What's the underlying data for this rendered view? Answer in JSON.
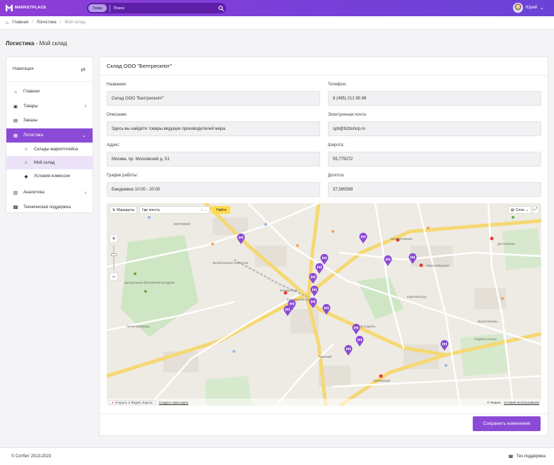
{
  "header": {
    "logo_text": "MARKETPLACE",
    "search_scope": "Товар",
    "search_placeholder": "Поиск",
    "user_name": "Юрий"
  },
  "breadcrumb": [
    "Главная",
    "Логистика",
    "Мой склад"
  ],
  "page_title": {
    "section": "Логистика",
    "rest": " - Мой склад"
  },
  "sidebar": {
    "title": "Навигация",
    "items": [
      {
        "label": "Главная",
        "icon": "home-icon"
      },
      {
        "label": "Товары",
        "icon": "box-icon"
      },
      {
        "label": "Заказы",
        "icon": "orders-icon"
      },
      {
        "label": "Логистика",
        "icon": "logistics-icon"
      },
      {
        "label": "Аналитика",
        "icon": "chart-icon"
      },
      {
        "label": "Техническая поддержка",
        "icon": "support-icon"
      }
    ],
    "subitems": [
      {
        "label": "Склады маркетплейса",
        "icon": "warehouses-icon"
      },
      {
        "label": "Мой склад",
        "icon": "warehouse-icon"
      },
      {
        "label": "Условия комиссии",
        "icon": "tag-icon"
      }
    ]
  },
  "card": {
    "title": "Склад ООО \"Белтрескпот\"",
    "fields": {
      "name": {
        "label": "Название:",
        "value": "Склад ООО \"Белтрескопт\""
      },
      "phone": {
        "label": "Телефон:",
        "value": "8 (495) 212 85 89"
      },
      "description": {
        "label": "Описание:",
        "value": "Здесь вы найдёте товары ведущих производителей мира."
      },
      "email": {
        "label": "Электронная почта:",
        "value": "spb@b2bshop.ru"
      },
      "address": {
        "label": "Адрес:",
        "value": "Москва, пр. Московский д. 51"
      },
      "latitude": {
        "label": "Широта:",
        "value": "55,775072"
      },
      "schedule": {
        "label": "График работы:",
        "value": "Ежедневно 10:00 - 20:00"
      },
      "longitude": {
        "label": "Долгота:",
        "value": "37,585569"
      }
    },
    "save_label": "Сохранить изменения"
  },
  "map": {
    "routes_label": "Маршруты",
    "search_placeholder": "Где поесть",
    "find_label": "Найти",
    "layers_label": "Слои",
    "open_in_yandex": "Открыть в Яндекс.Картах",
    "create_map": "Создать свою карту",
    "copyright": "© Яндекс",
    "terms": "Условия использования",
    "places": [
      "ВЕРХОВОЙ",
      "Менделеевская",
      "Новослободская",
      "Достоевская",
      "Белорусская",
      "Белорусский вокзал",
      "Маяковская",
      "Садовое кольцо",
      "Музей русского искусства",
      "Центральный Московский ипподром",
      "Геологоразведка",
      "Музей Москвы",
      "Музей усадьбы",
      "Гимназия",
      "Каретный ряд"
    ]
  },
  "footer": {
    "copyright": "© Сотбит 2013-2023",
    "support": "Тех.поддержка"
  }
}
